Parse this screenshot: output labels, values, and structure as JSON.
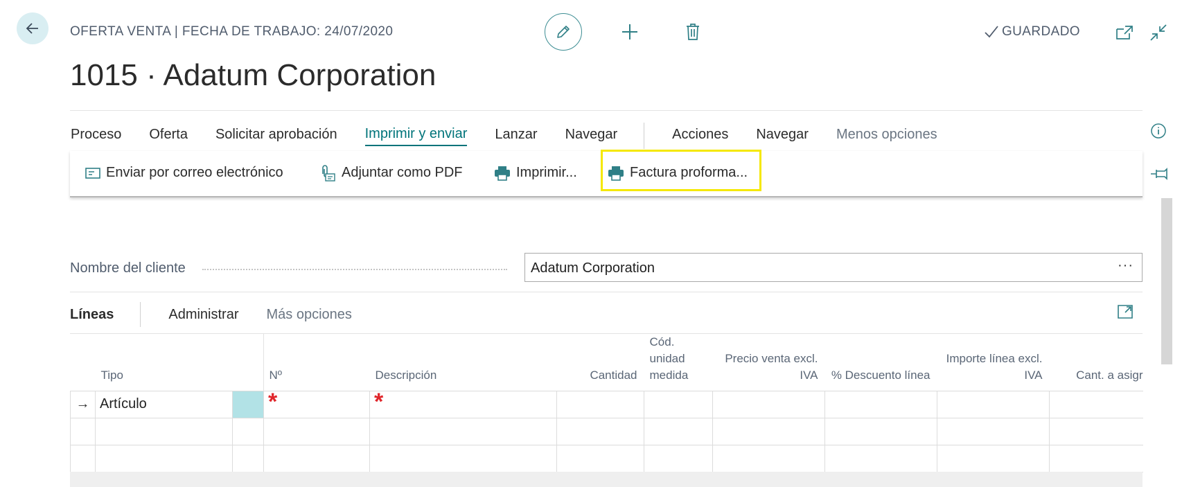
{
  "header": {
    "caption": "OFERTA VENTA | FECHA DE TRABAJO: 24/07/2020",
    "title": "1015 · Adatum Corporation",
    "status": "GUARDADO"
  },
  "menu": {
    "items": [
      {
        "label": "Proceso"
      },
      {
        "label": "Oferta"
      },
      {
        "label": "Solicitar aprobación"
      },
      {
        "label": "Imprimir y enviar",
        "active": true
      },
      {
        "label": "Lanzar"
      },
      {
        "label": "Navegar"
      }
    ],
    "secondary": [
      {
        "label": "Acciones"
      },
      {
        "label": "Navegar"
      },
      {
        "label": "Menos opciones"
      }
    ]
  },
  "actions": [
    {
      "label": "Enviar por correo electrónico",
      "icon": "email-icon"
    },
    {
      "label": "Adjuntar como PDF",
      "icon": "attach-pdf-icon"
    },
    {
      "label": "Imprimir...",
      "icon": "printer-icon"
    },
    {
      "label": "Factura proforma...",
      "icon": "printer-icon",
      "highlighted": true
    }
  ],
  "customer": {
    "label": "Nombre del cliente",
    "value": "Adatum Corporation",
    "more": "···"
  },
  "lines": {
    "title": "Líneas",
    "tabs": [
      "Administrar",
      "Más opciones"
    ],
    "columns": [
      {
        "label": "Tipo"
      },
      {
        "label": "Nº"
      },
      {
        "label": "Descripción"
      },
      {
        "label": "Cantidad"
      },
      {
        "label": "Cód. unidad medida"
      },
      {
        "label": "Precio venta excl. IVA"
      },
      {
        "label": "% Descuento línea"
      },
      {
        "label": "Importe línea excl. IVA"
      },
      {
        "label": "Cant. a asigr"
      }
    ],
    "rows": [
      {
        "indicator": "→",
        "type": "Artículo",
        "no": "*",
        "description": "*"
      },
      {
        "indicator": "",
        "type": "",
        "no": "",
        "description": ""
      },
      {
        "indicator": "",
        "type": "",
        "no": "",
        "description": ""
      }
    ]
  },
  "colors": {
    "accent": "#00747a",
    "highlight": "#f5e800",
    "required": "#e0262b",
    "selected_cell": "#b2e2e6"
  }
}
